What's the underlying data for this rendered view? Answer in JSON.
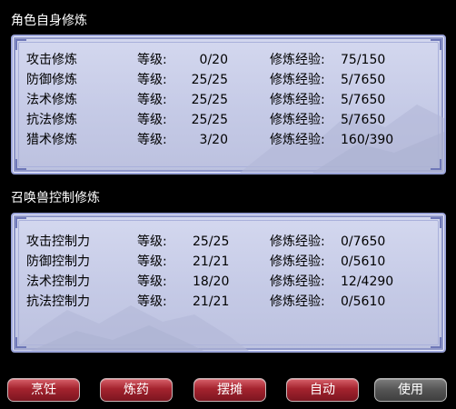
{
  "sections": {
    "self": {
      "title": "角色自身修炼",
      "level_label": "等级:",
      "exp_label": "修炼经验:",
      "rows": [
        {
          "name": "攻击修炼",
          "level": "0/20",
          "exp": "75/150"
        },
        {
          "name": "防御修炼",
          "level": "25/25",
          "exp": "5/7650"
        },
        {
          "name": "法术修炼",
          "level": "25/25",
          "exp": "5/7650"
        },
        {
          "name": "抗法修炼",
          "level": "25/25",
          "exp": "5/7650"
        },
        {
          "name": "猎术修炼",
          "level": "3/20",
          "exp": "160/390"
        }
      ]
    },
    "pet": {
      "title": "召唤兽控制修炼",
      "level_label": "等级:",
      "exp_label": "修炼经验:",
      "rows": [
        {
          "name": "攻击控制力",
          "level": "25/25",
          "exp": "0/7650"
        },
        {
          "name": "防御控制力",
          "level": "21/21",
          "exp": "0/5610"
        },
        {
          "name": "法术控制力",
          "level": "18/20",
          "exp": "12/4290"
        },
        {
          "name": "抗法控制力",
          "level": "21/21",
          "exp": "0/5610"
        }
      ]
    }
  },
  "buttons": {
    "cook": "烹饪",
    "alchemy": "炼药",
    "stall": "摆摊",
    "auto": "自动",
    "use": "使用"
  },
  "colors": {
    "panel_bg": "#c5cae6",
    "panel_border": "#9aa3d8",
    "button_red": "#a4232e",
    "button_gray": "#545454"
  }
}
